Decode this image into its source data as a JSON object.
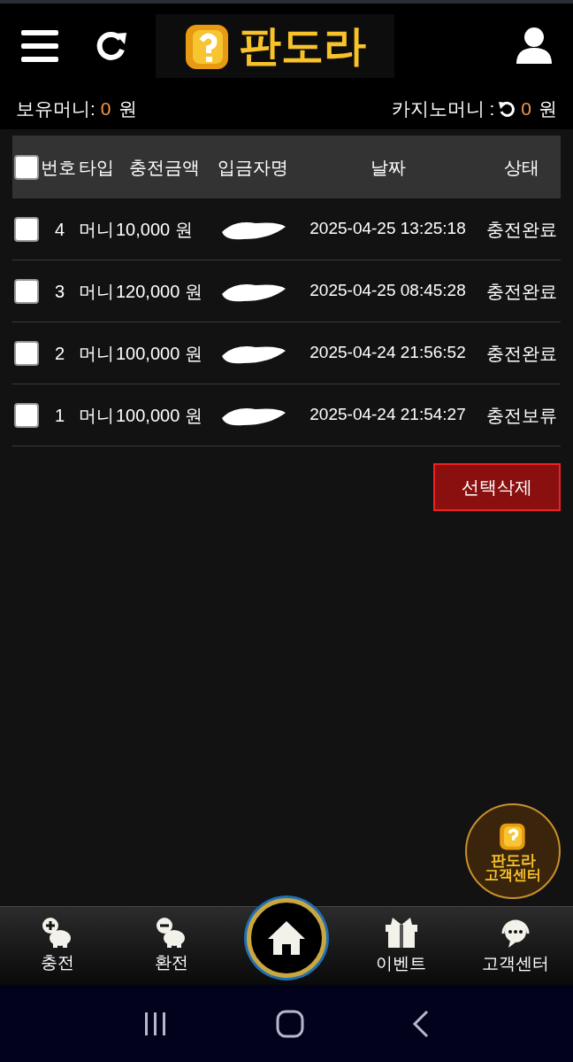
{
  "header": {
    "logo": "판도라"
  },
  "balance": {
    "held_label": "보유머니:",
    "held_value": "0",
    "held_unit": "원",
    "casino_label": "카지노머니 :",
    "casino_value": "0",
    "casino_unit": "원"
  },
  "table": {
    "select_all_checked": false,
    "columns": [
      "번호",
      "타입",
      "충전금액",
      "입금자명",
      "날짜",
      "상태"
    ],
    "rows": [
      {
        "checked": false,
        "no": "4",
        "type": "머니",
        "amount": "10,000 원",
        "date": "2025-04-25 13:25:18",
        "status": "충전완료"
      },
      {
        "checked": false,
        "no": "3",
        "type": "머니",
        "amount": "120,000 원",
        "date": "2025-04-25 08:45:28",
        "status": "충전완료"
      },
      {
        "checked": false,
        "no": "2",
        "type": "머니",
        "amount": "100,000 원",
        "date": "2025-04-24 21:56:52",
        "status": "충전완료"
      },
      {
        "checked": false,
        "no": "1",
        "type": "머니",
        "amount": "100,000 원",
        "date": "2025-04-24 21:54:27",
        "status": "충전보류"
      }
    ]
  },
  "delete_button": "선택삭제",
  "support_badge": {
    "title": "판도라",
    "subtitle": "고객센터"
  },
  "bottom_nav": [
    {
      "kind": "charge",
      "label": "충전"
    },
    {
      "kind": "exchange",
      "label": "환전"
    },
    {
      "kind": "home"
    },
    {
      "kind": "event",
      "label": "이벤트"
    },
    {
      "kind": "support",
      "label": "고객센터"
    }
  ]
}
